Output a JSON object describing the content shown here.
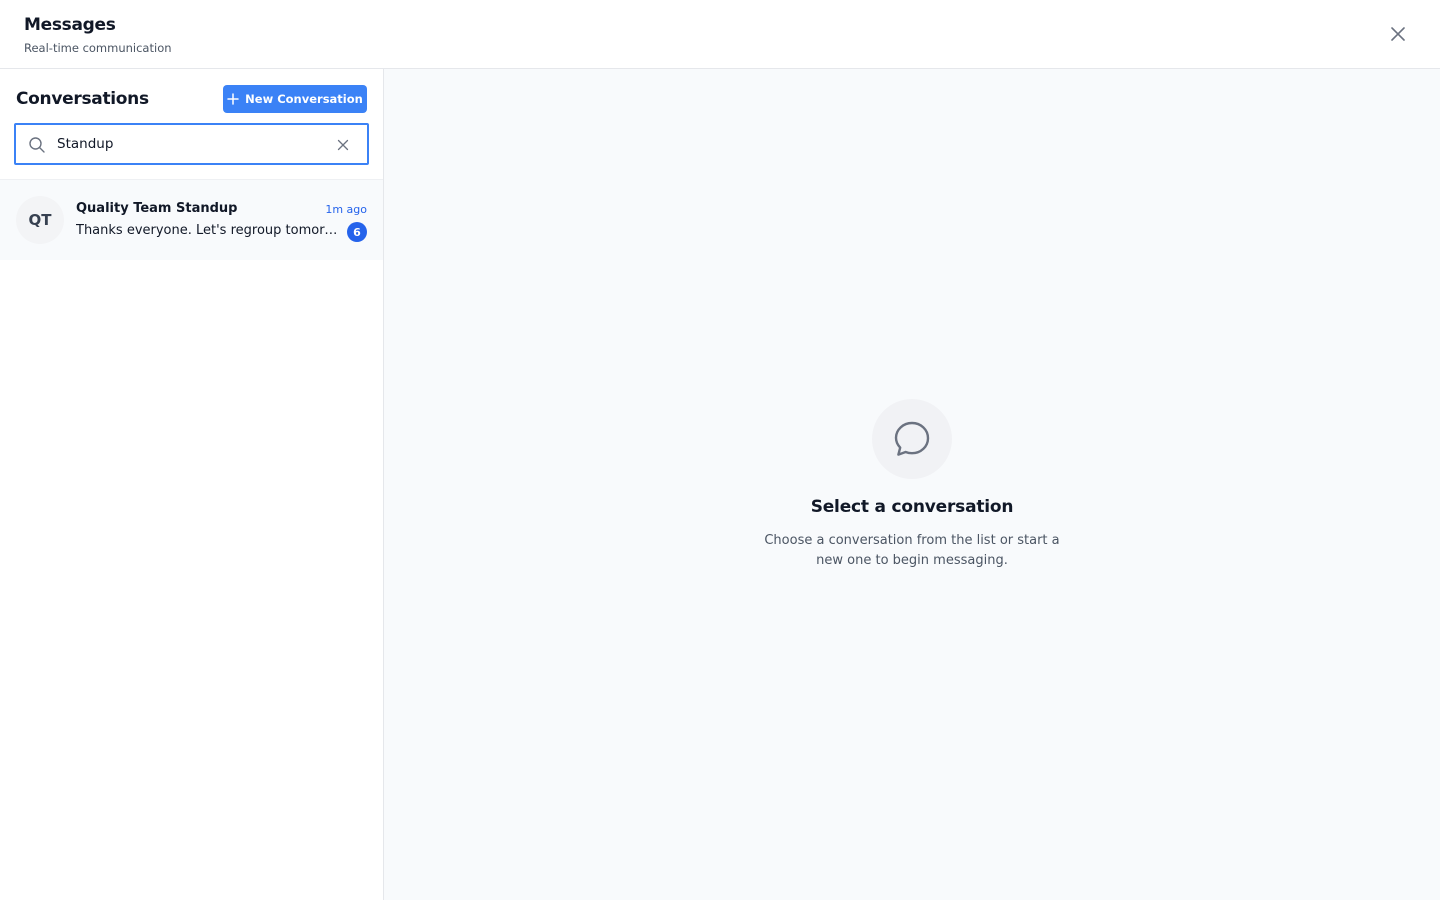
{
  "header": {
    "title": "Messages",
    "subtitle": "Real-time communication",
    "close_icon": "close-icon"
  },
  "sidebar": {
    "title": "Conversations",
    "new_button_label": "New Conversation",
    "new_button_icon": "plus-icon",
    "search": {
      "value": "Standup",
      "icon": "search-icon",
      "clear_icon": "clear-icon"
    },
    "conversations": [
      {
        "initials": "QT",
        "name": "Quality Team Standup",
        "time": "1m ago",
        "preview": "Thanks everyone. Let's regroup tomorrow.",
        "unread": "6"
      }
    ]
  },
  "main": {
    "empty_icon": "chat-bubble-icon",
    "empty_title": "Select a conversation",
    "empty_description": "Choose a conversation from the list or start a new one to begin messaging."
  },
  "colors": {
    "accent": "#3b82f6",
    "badge": "#2563eb",
    "time": "#2563eb"
  }
}
